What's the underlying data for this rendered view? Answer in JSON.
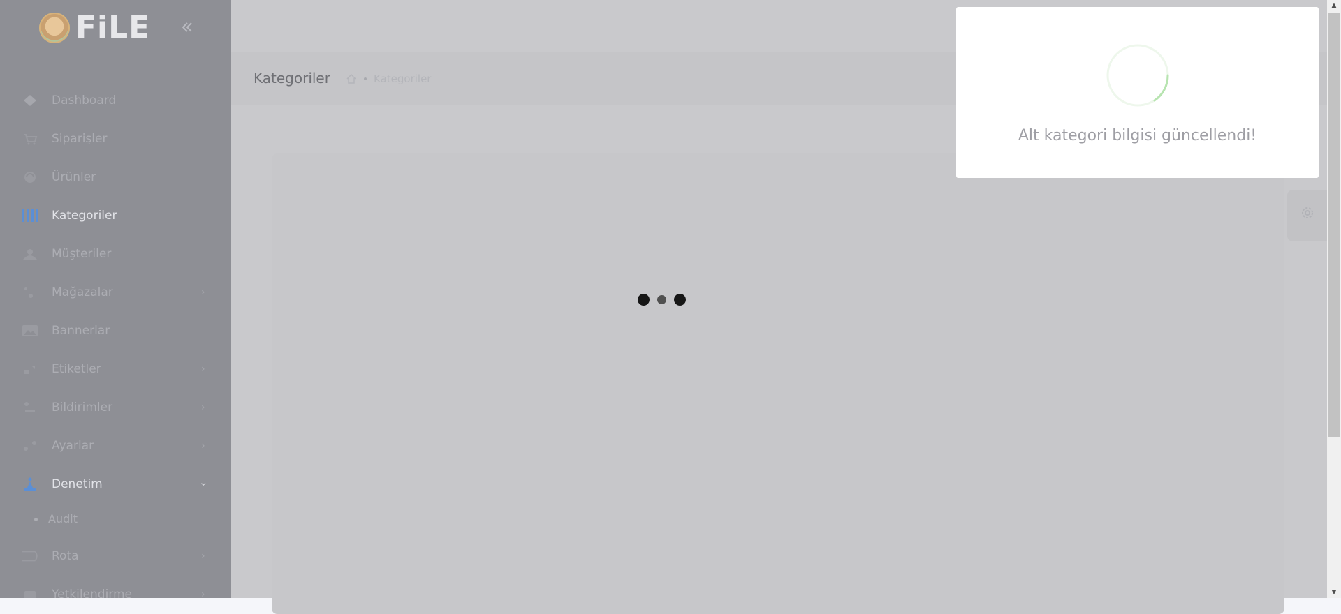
{
  "brand": {
    "name": "FiLE"
  },
  "sidebar": {
    "items": [
      {
        "label": "Dashboard",
        "icon": "dashboard-icon"
      },
      {
        "label": "Siparişler",
        "icon": "cart-icon"
      },
      {
        "label": "Ürünler",
        "icon": "products-icon"
      },
      {
        "label": "Kategoriler",
        "icon": "categories-icon",
        "active": true
      },
      {
        "label": "Müşteriler",
        "icon": "customers-icon"
      },
      {
        "label": "Mağazalar",
        "icon": "stores-icon",
        "has_arrow": true
      },
      {
        "label": "Bannerlar",
        "icon": "banner-icon"
      },
      {
        "label": "Etiketler",
        "icon": "tags-icon",
        "has_arrow": true
      },
      {
        "label": "Bildirimler",
        "icon": "notifications-icon",
        "has_arrow": true
      },
      {
        "label": "Ayarlar",
        "icon": "settings-icon",
        "has_arrow": true
      },
      {
        "label": "Denetim",
        "icon": "audit-icon",
        "has_arrow": true,
        "expanded": true
      },
      {
        "label": "Rota",
        "icon": "route-icon",
        "has_arrow": true
      },
      {
        "label": "Yetkilendirme",
        "icon": "authorization-icon",
        "has_arrow": true
      }
    ],
    "sub_items": [
      {
        "label": "Audit"
      }
    ]
  },
  "toolbar": {
    "page_title": "Kategoriler",
    "breadcrumb": {
      "current": "Kategoriler"
    }
  },
  "toast": {
    "message": "Alt kategori bilgisi güncellendi!",
    "status": "loading"
  },
  "colors": {
    "sidebar": "#8e8f95",
    "overlay": "#c9c9cc",
    "accent": "#5b8fd6",
    "spinner": "#b7e4b0"
  }
}
